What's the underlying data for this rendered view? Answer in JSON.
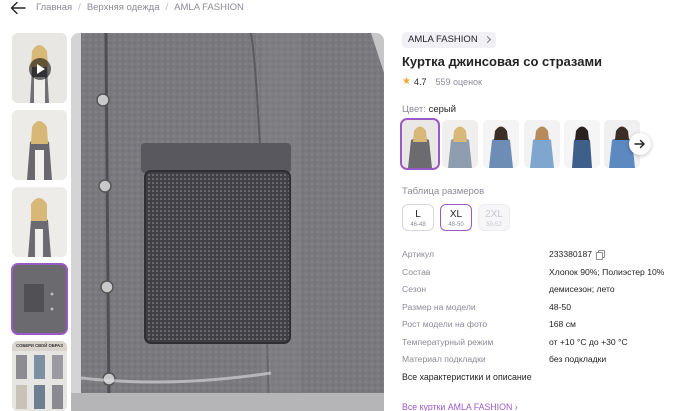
{
  "breadcrumb": {
    "items": [
      "Главная",
      "Верхняя одежда",
      "AMLA FASHION"
    ],
    "separator": "/"
  },
  "product": {
    "brand": "AMLA FASHION",
    "title": "Куртка джинсовая со стразами",
    "rating": "4.7",
    "reviews": "559 оценок",
    "color_label": "Цвет:",
    "color_value": "серый",
    "size_table_label": "Таблица размеров",
    "sizes": [
      {
        "size": "L",
        "range": "46-48",
        "state": "normal"
      },
      {
        "size": "XL",
        "range": "48-50",
        "state": "selected"
      },
      {
        "size": "2XL",
        "range": "50-52",
        "state": "disabled"
      }
    ],
    "specs": [
      {
        "key": "Артикул",
        "value": "233380187"
      },
      {
        "key": "Состав",
        "value": "Хлопок 90%; Полиэстер 10%"
      },
      {
        "key": "Сезон",
        "value": "демисезон; лето"
      },
      {
        "key": "Размер на модели",
        "value": "48-50"
      },
      {
        "key": "Рост модели на фото",
        "value": "168 см"
      },
      {
        "key": "Температурный режим",
        "value": "от +10 °C до +30 °C"
      },
      {
        "key": "Материал подкладки",
        "value": "без подкладки"
      }
    ],
    "all_specs_link": "Все характеристики и описание",
    "all_brand_link": "Все куртки AMLA FASHION ›"
  },
  "thumbnail_banner_text": "СОБЕРИ СВОЙ ОБРАЗ",
  "colors": {
    "accent": "#9b59c6",
    "star": "#f5a623",
    "muted": "#8b8b99"
  }
}
